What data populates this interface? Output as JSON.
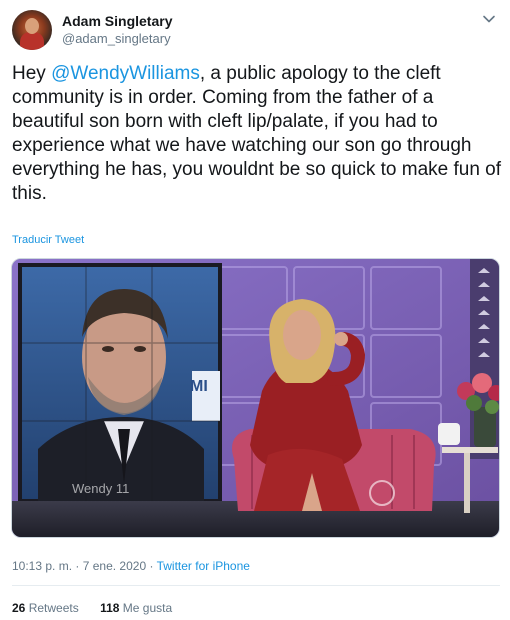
{
  "author": {
    "name": "Adam Singletary",
    "handle": "@adam_singletary"
  },
  "tweet": {
    "text_before": "Hey ",
    "mention": "@WendyWilliams",
    "text_after": ", a public apology to the cleft community is in order. Coming from the father of a beautiful son born with cleft lip/palate, if you had to experience what we have watching our son go through everything he has, you wouldnt be so quick to make fun of this.",
    "translate_label": "Traducir Tweet"
  },
  "media": {
    "overlay_text": "Wendy 11",
    "screen_text": "MI"
  },
  "meta": {
    "time": "10:13 p. m.",
    "separator": " · ",
    "date": "7 ene. 2020",
    "source": "Twitter for iPhone"
  },
  "stats": {
    "retweets_count": "26",
    "retweets_label": "Retweets",
    "likes_count": "118",
    "likes_label": "Me gusta"
  },
  "colors": {
    "link": "#1b95e0",
    "text": "#14171a",
    "secondary": "#657786"
  },
  "icons": [
    "chevron-down-icon"
  ]
}
